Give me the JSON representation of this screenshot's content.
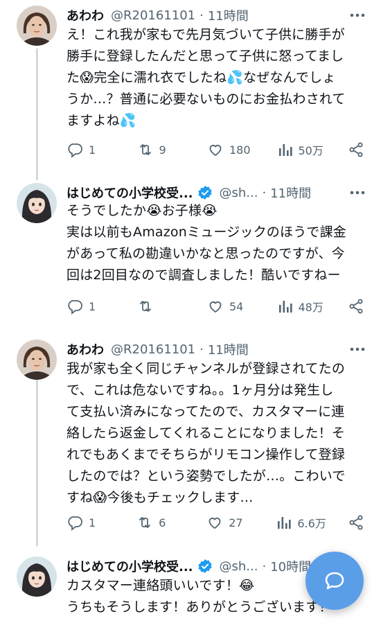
{
  "tweets": [
    {
      "name": "あわわ",
      "handle": "@R20161101",
      "sep": "·",
      "time": "11時間",
      "verified": false,
      "avatar": "woman-photo",
      "lines": [
        "え！これ我が家もで先月気づいて子供に勝手が",
        "勝手に登録したんだと思って子供に怒ってまし",
        "た😱完全に濡れ衣でしたね💦なぜなんでしょ",
        "うか…？普通に必要ないものにお金払わされて",
        "ますよね💦"
      ],
      "replies": "1",
      "retweets": "9",
      "likes": "180",
      "views": "50万"
    },
    {
      "name": "はじめての小学校受...",
      "handle": "@sh...",
      "sep": "·",
      "time": "11時間",
      "verified": true,
      "avatar": "anime-girl",
      "lines": [
        "そうでしたか😭お子様😭",
        "実は以前もAmazonミュージックのほうで課金",
        "があって私の勘違いかなと思ったのですが、今",
        "回は2回目なので調査しました！酷いですねー"
      ],
      "replies": "1",
      "retweets": "",
      "likes": "54",
      "views": "48万"
    },
    {
      "name": "あわわ",
      "handle": "@R20161101",
      "sep": "·",
      "time": "11時間",
      "verified": false,
      "avatar": "woman-photo",
      "lines": [
        "我が家も全く同じチャンネルが登録されてたの",
        "で、これは危ないですね。。1ヶ月分は発生し",
        "て支払い済みになってたので、カスタマーに連",
        "絡したら返金してくれることになりました！そ",
        "れでもあくまでそちらがリモコン操作して登録",
        "したのでは？という姿勢でしたが…。こわいで",
        "すね😱今後もチェックします…"
      ],
      "replies": "1",
      "retweets": "6",
      "likes": "27",
      "views": "6.6万"
    },
    {
      "name": "はじめての小学校受...",
      "handle": "@sh...",
      "sep": "·",
      "time": "10時間",
      "verified": true,
      "avatar": "anime-girl",
      "lines": [
        "カスタマー連絡頭いいです！😂",
        "うちもそうします！ありがとうございます！"
      ]
    }
  ],
  "colors": {
    "text": "#0f1419",
    "secondary": "#536471",
    "verified": "#1d9bf0",
    "fab": "#5b9ee8",
    "thread_line": "#cfd9de"
  },
  "fab": {
    "icon": "chat-bubble-icon"
  }
}
